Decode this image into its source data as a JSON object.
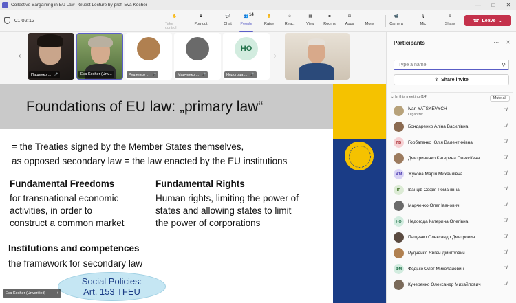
{
  "window": {
    "title": "Collective Bargaining in EU Law - Guest Lecture by prof. Eva Kocher",
    "controls": [
      "—",
      "□",
      "✕"
    ]
  },
  "toolbar": {
    "timer": "01:02:12",
    "buttons": [
      {
        "label": "Take control",
        "icon": "hand-icon",
        "state": "disabled"
      },
      {
        "label": "Pop out",
        "icon": "popout-icon",
        "state": "normal"
      },
      {
        "label": "Chat",
        "icon": "chat-icon",
        "state": "normal"
      },
      {
        "label": "People",
        "icon": "people-icon",
        "state": "active",
        "badge": "14"
      },
      {
        "label": "Raise",
        "icon": "raise-hand-icon",
        "state": "normal"
      },
      {
        "label": "React",
        "icon": "react-icon",
        "state": "normal"
      },
      {
        "label": "View",
        "icon": "view-icon",
        "state": "normal"
      },
      {
        "label": "Rooms",
        "icon": "rooms-icon",
        "state": "normal"
      },
      {
        "label": "Apps",
        "icon": "apps-icon",
        "state": "normal"
      },
      {
        "label": "More",
        "icon": "more-icon",
        "state": "normal"
      },
      {
        "label": "Camera",
        "icon": "camera-icon",
        "state": "normal"
      },
      {
        "label": "Mic",
        "icon": "mic-icon",
        "state": "normal"
      },
      {
        "label": "Share",
        "icon": "share-icon",
        "state": "normal"
      }
    ],
    "leave_label": "Leave"
  },
  "video_tiles": [
    {
      "name": "Пащенко ...",
      "type": "video"
    },
    {
      "name": "Eva Kocher (Unv...",
      "type": "video"
    },
    {
      "name": "Рудченко ...",
      "type": "photo"
    },
    {
      "name": "Марченко ...",
      "type": "photo"
    },
    {
      "name": "Недогода ...",
      "type": "initials",
      "initials": "НО"
    }
  ],
  "slide": {
    "heading": "Foundations of EU law: „primary law“",
    "line1": "= the Treaties signed by the Member States themselves,",
    "line2": "as opposed secondary law = the law enacted by the EU institutions",
    "freedoms": {
      "heading": "Fundamental Freedoms",
      "body": [
        "for transnational economic",
        "activities, in order to",
        "construct a common market"
      ]
    },
    "rights": {
      "heading": "Fundamental Rights",
      "body": [
        "Human rights, limiting the power of",
        "states and allowing states to limit",
        "the power of corporations"
      ]
    },
    "institutions": {
      "heading": "Institutions and competences",
      "body": "the framework for secondary law"
    },
    "bubble": [
      "Social Policies:",
      "Art. 153 TFEU"
    ],
    "colors": {
      "flag_yellow": "#f5c200",
      "flag_blue": "#1a3c86"
    }
  },
  "presenter_tag": "Eva Kocher (Unverified)",
  "participants_panel": {
    "title": "Participants",
    "search_placeholder": "Type a name",
    "share_invite": "Share invite",
    "section_label": "In this meeting (14)",
    "mute_all": "Mute all",
    "participants": [
      {
        "name": "Ivan YATSKEVYCH",
        "role": "Organizer",
        "avatar": "photo",
        "color": "#b7a27a"
      },
      {
        "name": "Бондаренко Аліна Василівна",
        "avatar": "photo",
        "color": "#8a6a50"
      },
      {
        "name": "Горбатенко Юлія Валентинівна",
        "avatar": "initials",
        "initials": "ГВ",
        "bg": "#f6d1d4",
        "fg": "#a4262c"
      },
      {
        "name": "Дмитриченко Катерина Олексіївна",
        "avatar": "photo",
        "color": "#9c7b5e"
      },
      {
        "name": "Жукова Марія Михайлівна",
        "avatar": "initials",
        "initials": "ЖМ",
        "bg": "#d9d3f5",
        "fg": "#4f3fb0"
      },
      {
        "name": "Іванців Софія Романівна",
        "avatar": "initials",
        "initials": "ІР",
        "bg": "#dcebd5",
        "fg": "#3b6e22"
      },
      {
        "name": "Марченко Олег Іванович",
        "avatar": "photo",
        "color": "#6a6a6a"
      },
      {
        "name": "Недогода Катерина Олегівна",
        "avatar": "initials",
        "initials": "НО",
        "bg": "#d2ecdf",
        "fg": "#1f6f47"
      },
      {
        "name": "Пащенко Олександр Дмитрович",
        "avatar": "photo",
        "color": "#5a4a40"
      },
      {
        "name": "Рудченко Євген Дмитрович",
        "avatar": "photo",
        "color": "#b08050"
      },
      {
        "name": "Федько Олег Миколайович",
        "avatar": "initials",
        "initials": "ФМ",
        "bg": "#d2ecdf",
        "fg": "#1f6f47"
      },
      {
        "name": "Кучеренко Олександр Михайлович",
        "avatar": "photo",
        "color": "#7a6a5a"
      }
    ]
  }
}
